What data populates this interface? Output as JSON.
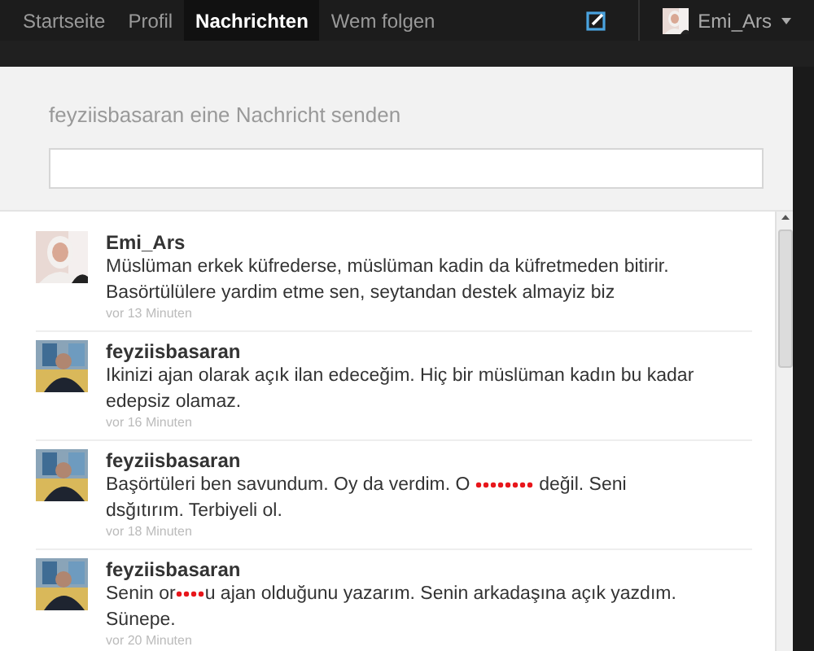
{
  "nav": {
    "tabs": [
      {
        "label": "Startseite",
        "selected": false
      },
      {
        "label": "Profil",
        "selected": false
      },
      {
        "label": "Nachrichten",
        "selected": true
      },
      {
        "label": "Wem folgen",
        "selected": false
      }
    ],
    "account": {
      "name": "Emi_Ars"
    }
  },
  "dialog": {
    "title": "feyziisbasaran eine Nachricht senden",
    "messages": [
      {
        "sender": "Emi_Ars",
        "parts": [
          {
            "kind": "text",
            "text": "Müslüman erkek küfrederse, müslüman kadin da küfretmeden bitirir. Basörtülülere yardim etme sen, seytandan destek almayiz biz"
          }
        ],
        "time": "vor 13 Minuten"
      },
      {
        "sender": "feyziisbasaran",
        "parts": [
          {
            "kind": "text",
            "text": "Ikinizi ajan olarak açık ilan edeceğim. Hiç bir müslüman kadın bu kadar edepsiz olamaz."
          }
        ],
        "time": "vor 16 Minuten"
      },
      {
        "sender": "feyziisbasaran",
        "parts": [
          {
            "kind": "text",
            "text": "Başörtüleri ben savundum. Oy da verdim. O "
          },
          {
            "kind": "redaction"
          },
          {
            "kind": "text",
            "text": " değil. Seni dsğıtırım. Terbiyeli ol."
          }
        ],
        "time": "vor 18 Minuten"
      },
      {
        "sender": "feyziisbasaran",
        "parts": [
          {
            "kind": "text",
            "text": "Senin or"
          },
          {
            "kind": "redaction"
          },
          {
            "kind": "text",
            "text": "u ajan olduğunu yazarım. Senin arkadaşına açık yazdım. Sünepe."
          }
        ],
        "time": "vor 20 Minuten"
      }
    ]
  }
}
